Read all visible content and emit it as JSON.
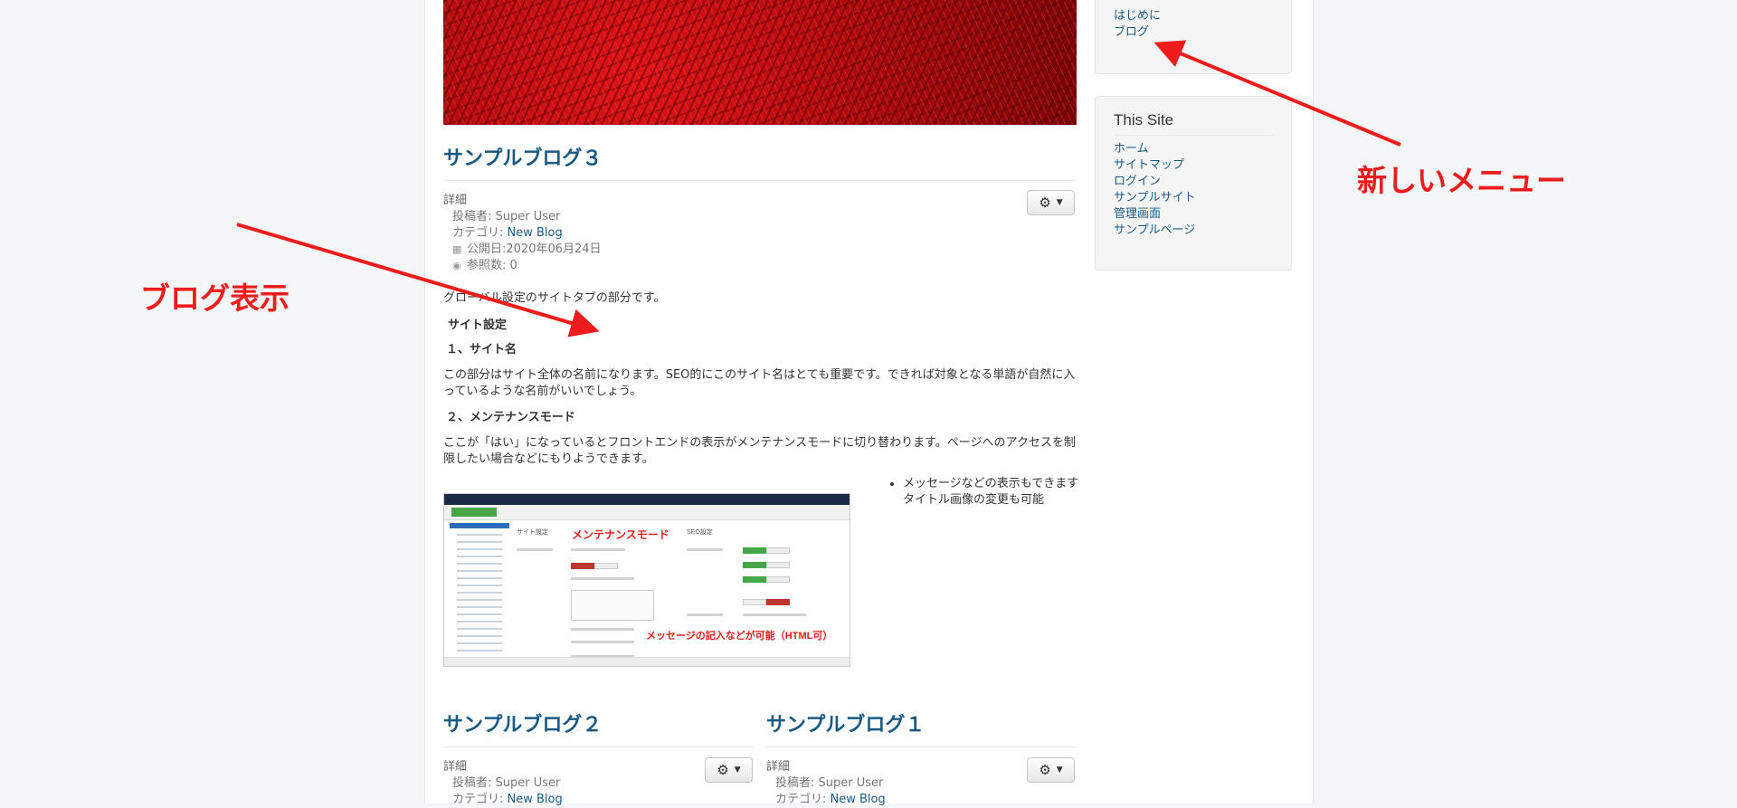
{
  "sidebar": {
    "top_menu": {
      "items": [
        "はじめに",
        "ブログ"
      ]
    },
    "this_site": {
      "title": "This Site",
      "items": [
        "ホーム",
        "サイトマップ",
        "ログイン",
        "サンプルサイト",
        "管理画面",
        "サンプルページ"
      ]
    }
  },
  "featured": {
    "title": "サンプルブログ３",
    "details_label": "詳細",
    "author": "投稿者: Super User",
    "category_prefix": "カテゴリ: ",
    "category": "New Blog",
    "published": "公開日:2020年06月24日",
    "hits": "参照数: 0",
    "intro": "グローバル設定のサイトタブの部分です。",
    "section_heading": "サイト設定",
    "h1": "１、サイト名",
    "p1": "この部分はサイト全体の名前になります。SEO的にこのサイト名はとても重要です。できれば対象となる単語が自然に入っているような名前がいいでしょう。",
    "h2": "２、メンテナンスモード",
    "p2": "ここが「はい」になっているとフロントエンドの表示がメンテナンスモードに切り替わります。ページへのアクセスを制限したい場合などにもりようできます。",
    "bullet": "メッセージなどの表示もできます",
    "bullet_line2": "タイトル画像の変更も可能",
    "screenshot": {
      "label_maintenance": "メンテナンスモード",
      "label_message": "メッセージの記入などが可能（HTML可）",
      "label_site": "サイト設定",
      "label_seo": "SEO設定"
    }
  },
  "articles": [
    {
      "title": "サンプルブログ２",
      "details_label": "詳細",
      "author": "投稿者: Super User",
      "category_prefix": "カテゴリ: ",
      "category": "New Blog"
    },
    {
      "title": "サンプルブログ１",
      "details_label": "詳細",
      "author": "投稿者: Super User",
      "category_prefix": "カテゴリ: ",
      "category": "New Blog"
    }
  ],
  "annotations": {
    "blog_display": "ブログ表示",
    "new_menu": "新しいメニュー",
    "color": "#ee1c1c"
  },
  "icons": {
    "gear": "gear-icon",
    "calendar": "calendar-icon",
    "eye": "eye-icon"
  }
}
